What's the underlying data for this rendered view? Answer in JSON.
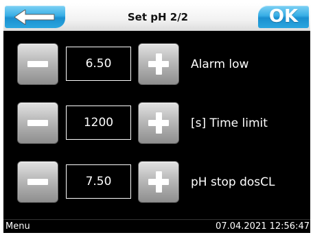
{
  "header": {
    "title": "Set pH 2/2",
    "back_icon": "arrow-left-icon",
    "ok_label": "OK",
    "accent_color": "#2ba6df"
  },
  "rows": [
    {
      "value": "6.50",
      "label": "Alarm low",
      "minus_icon": "minus-icon",
      "plus_icon": "plus-icon"
    },
    {
      "value": "1200",
      "label": "[s] Time limit",
      "minus_icon": "minus-icon",
      "plus_icon": "plus-icon"
    },
    {
      "value": "7.50",
      "label": "pH stop dosCL",
      "minus_icon": "minus-icon",
      "plus_icon": "plus-icon"
    }
  ],
  "footer": {
    "menu_label": "Menu",
    "datetime": "07.04.2021 12:56:47"
  }
}
